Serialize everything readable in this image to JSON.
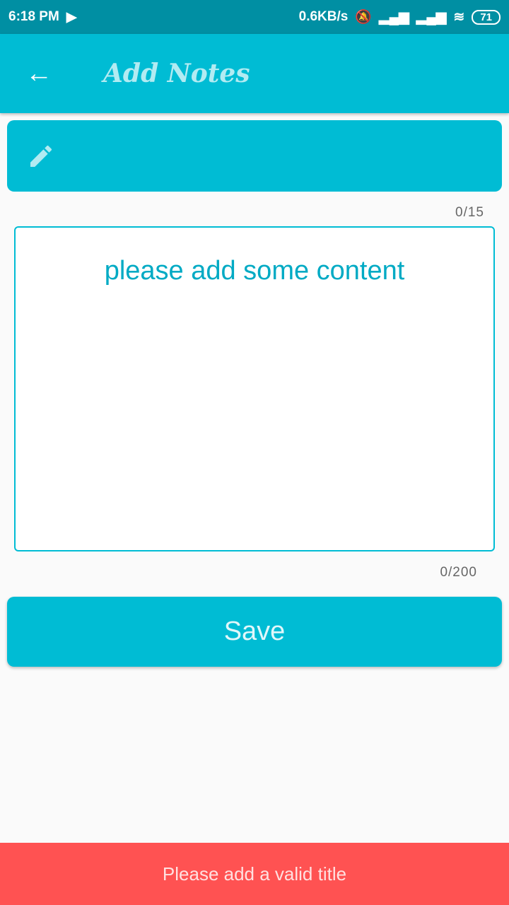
{
  "status_bar": {
    "time": "6:18 PM",
    "net_speed": "0.6KB/s",
    "battery": "71"
  },
  "app_bar": {
    "title": "Add Notes"
  },
  "form": {
    "title_counter": "0/15",
    "content_placeholder": "please add some content",
    "content_counter": "0/200",
    "save_label": "Save"
  },
  "snackbar": {
    "message": "Please add a valid title"
  },
  "colors": {
    "primary": "#00bcd4",
    "status": "#008fa3",
    "error": "#ff5252"
  }
}
